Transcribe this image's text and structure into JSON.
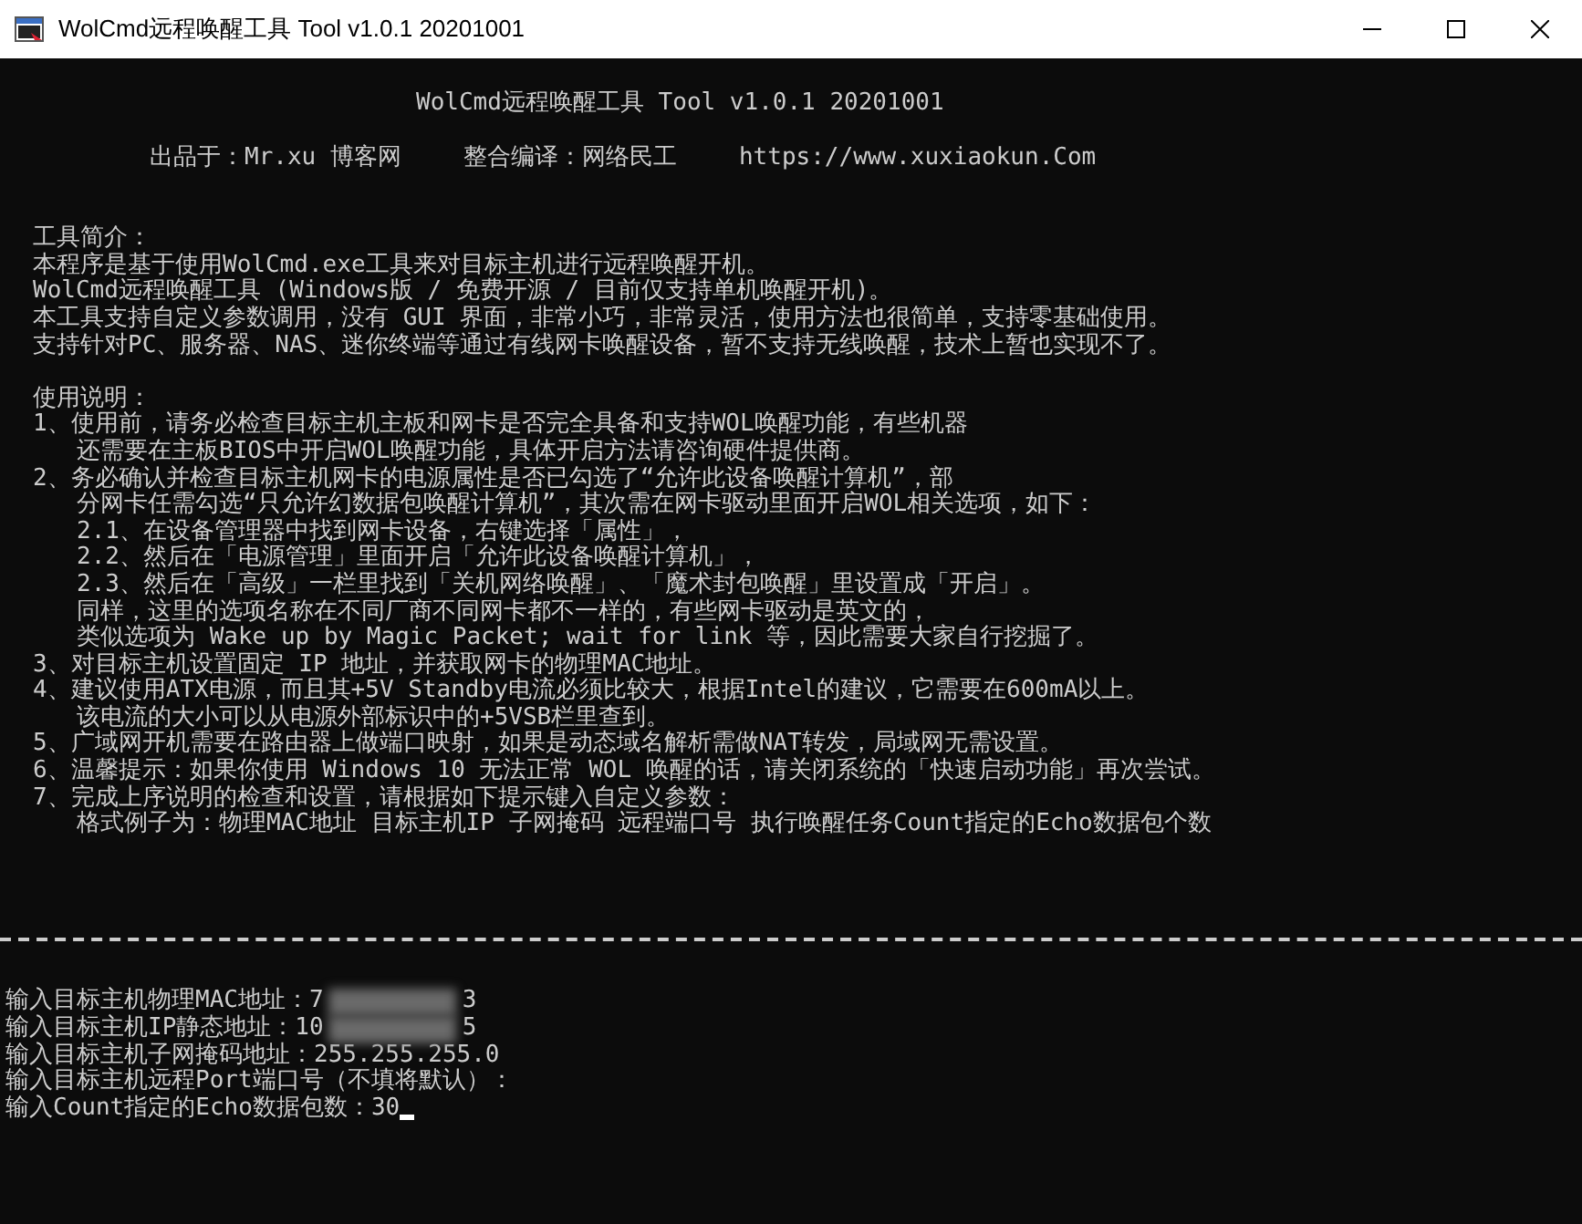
{
  "window": {
    "title": "WolCmd远程唤醒工具 Tool v1.0.1 20201001"
  },
  "console": {
    "banner": {
      "title": "WolCmd远程唤醒工具 Tool v1.0.1 20201001",
      "credits": [
        "出品于：Mr.xu 博客网",
        "整合编译：网络民工",
        "https://www.xuxiaokun.Com"
      ]
    },
    "intro": {
      "heading": "工具简介：",
      "lines": [
        "本程序是基于使用WolCmd.exe工具来对目标主机进行远程唤醒开机。",
        "WolCmd远程唤醒工具 (Windows版 / 免费开源 / 目前仅支持单机唤醒开机)。",
        "本工具支持自定义参数调用，没有 GUI 界面，非常小巧，非常灵活，使用方法也很简单，支持零基础使用。",
        "支持针对PC、服务器、NAS、迷你终端等通过有线网卡唤醒设备，暂不支持无线唤醒，技术上暂也实现不了。"
      ]
    },
    "usage": {
      "heading": "使用说明：",
      "items": [
        {
          "lines": [
            "1、使用前，请务必检查目标主机主板和网卡是否完全具备和支持WOL唤醒功能，有些机器",
            "还需要在主板BIOS中开启WOL唤醒功能，具体开启方法请咨询硬件提供商。"
          ]
        },
        {
          "lines": [
            "2、务必确认并检查目标主机网卡的电源属性是否已勾选了“允许此设备唤醒计算机”，部",
            "分网卡任需勾选“只允许幻数据包唤醒计算机”，其次需在网卡驱动里面开启WOL相关选项，如下："
          ],
          "children": [
            {
              "lines": [
                "2.1、在设备管理器中找到网卡设备，右键选择「属性」，"
              ]
            },
            {
              "lines": [
                "2.2、然后在「电源管理」里面开启「允许此设备唤醒计算机」，"
              ]
            },
            {
              "lines": [
                "2.3、然后在「高级」一栏里找到「关机网络唤醒」、「魔术封包唤醒」里设置成「开启」。"
              ]
            }
          ],
          "notes": [
            "同样，这里的选项名称在不同厂商不同网卡都不一样的，有些网卡驱动是英文的，",
            "类似选项为 Wake up by Magic Packet; wait for link 等，因此需要大家自行挖掘了。"
          ]
        },
        {
          "lines": [
            "3、对目标主机设置固定 IP 地址，并获取网卡的物理MAC地址。"
          ]
        },
        {
          "lines": [
            "4、建议使用ATX电源，而且其+5V Standby电流必须比较大，根据Intel的建议，它需要在600mA以上。",
            "该电流的大小可以从电源外部标识中的+5VSB栏里查到。"
          ]
        },
        {
          "lines": [
            "5、广域网开机需要在路由器上做端口映射，如果是动态域名解析需做NAT转发，局域网无需设置。"
          ]
        },
        {
          "lines": [
            "6、温馨提示：如果你使用 Windows 10 无法正常 WOL 唤醒的话，请关闭系统的「快速启动功能」再次尝试。"
          ]
        },
        {
          "lines": [
            "7、完成上序说明的检查和设置，请根据如下提示键入自定义参数：",
            "格式例子为：物理MAC地址 目标主机IP 子网掩码 远程端口号 执行唤醒任务Count指定的Echo数据包个数"
          ]
        }
      ]
    },
    "inputs": [
      {
        "prompt": "输入目标主机物理MAC地址：",
        "value": "7",
        "masked": true,
        "value_end": "3"
      },
      {
        "prompt": "输入目标主机IP静态地址：",
        "value": "10",
        "masked": true,
        "value_end": "5"
      },
      {
        "prompt": "输入目标主机子网掩码地址：",
        "value": "255.255.255.0"
      },
      {
        "prompt": "输入目标主机远程Port端口号（不填将默认）："
      },
      {
        "prompt": "输入Count指定的Echo数据包数：",
        "value": "30",
        "cursor": true
      }
    ]
  }
}
